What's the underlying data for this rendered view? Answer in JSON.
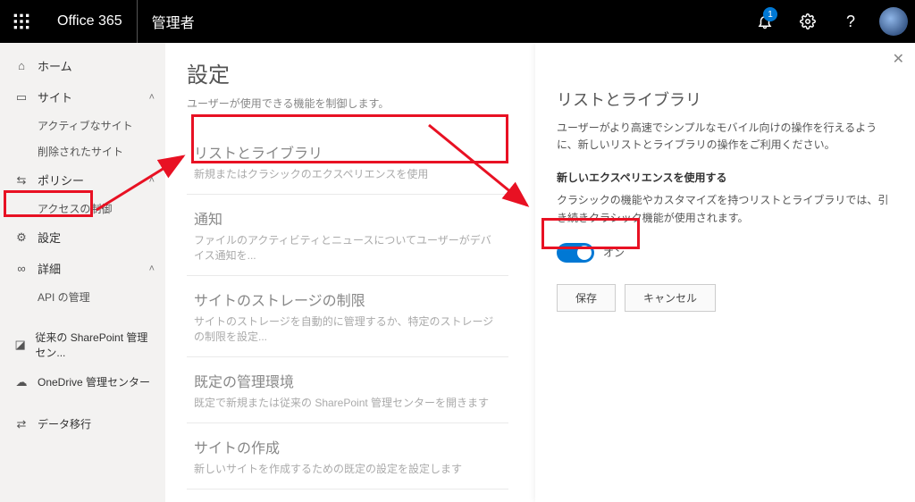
{
  "header": {
    "brand": "Office 365",
    "app": "管理者",
    "notification_count": "1"
  },
  "sidebar": {
    "home": "ホーム",
    "site": "サイト",
    "site_active": "アクティブなサイト",
    "site_deleted": "削除されたサイト",
    "policy": "ポリシー",
    "access_control": "アクセスの制御",
    "settings": "設定",
    "details": "詳細",
    "api_mgmt": "API の管理",
    "classic_admin": "従来の SharePoint 管理セン...",
    "onedrive_admin": "OneDrive 管理センター",
    "data_migration": "データ移行"
  },
  "main": {
    "title": "設定",
    "desc": "ユーザーが使用できる機能を制御します。",
    "cards": {
      "lists": {
        "title": "リストとライブラリ",
        "desc": "新規またはクラシックのエクスペリエンスを使用"
      },
      "notify": {
        "title": "通知",
        "desc": "ファイルのアクティビティとニュースについてユーザーがデバイス通知を..."
      },
      "storage": {
        "title": "サイトのストレージの制限",
        "desc": "サイトのストレージを自動的に管理するか、特定のストレージの制限を設定..."
      },
      "admin_env": {
        "title": "既定の管理環境",
        "desc": "既定で新規または従来の SharePoint 管理センターを開きます"
      },
      "site_create": {
        "title": "サイトの作成",
        "desc": "新しいサイトを作成するための既定の設定を設定します"
      }
    }
  },
  "panel": {
    "title": "リストとライブラリ",
    "desc": "ユーザーがより高速でシンプルなモバイル向けの操作を行えるように、新しいリストとライブラリの操作をご利用ください。",
    "sub_title": "新しいエクスペリエンスを使用する",
    "note": "クラシックの機能やカスタマイズを持つリストとライブラリでは、引き続きクラシック機能が使用されます。",
    "toggle_label": "オン",
    "save": "保存",
    "cancel": "キャンセル"
  }
}
